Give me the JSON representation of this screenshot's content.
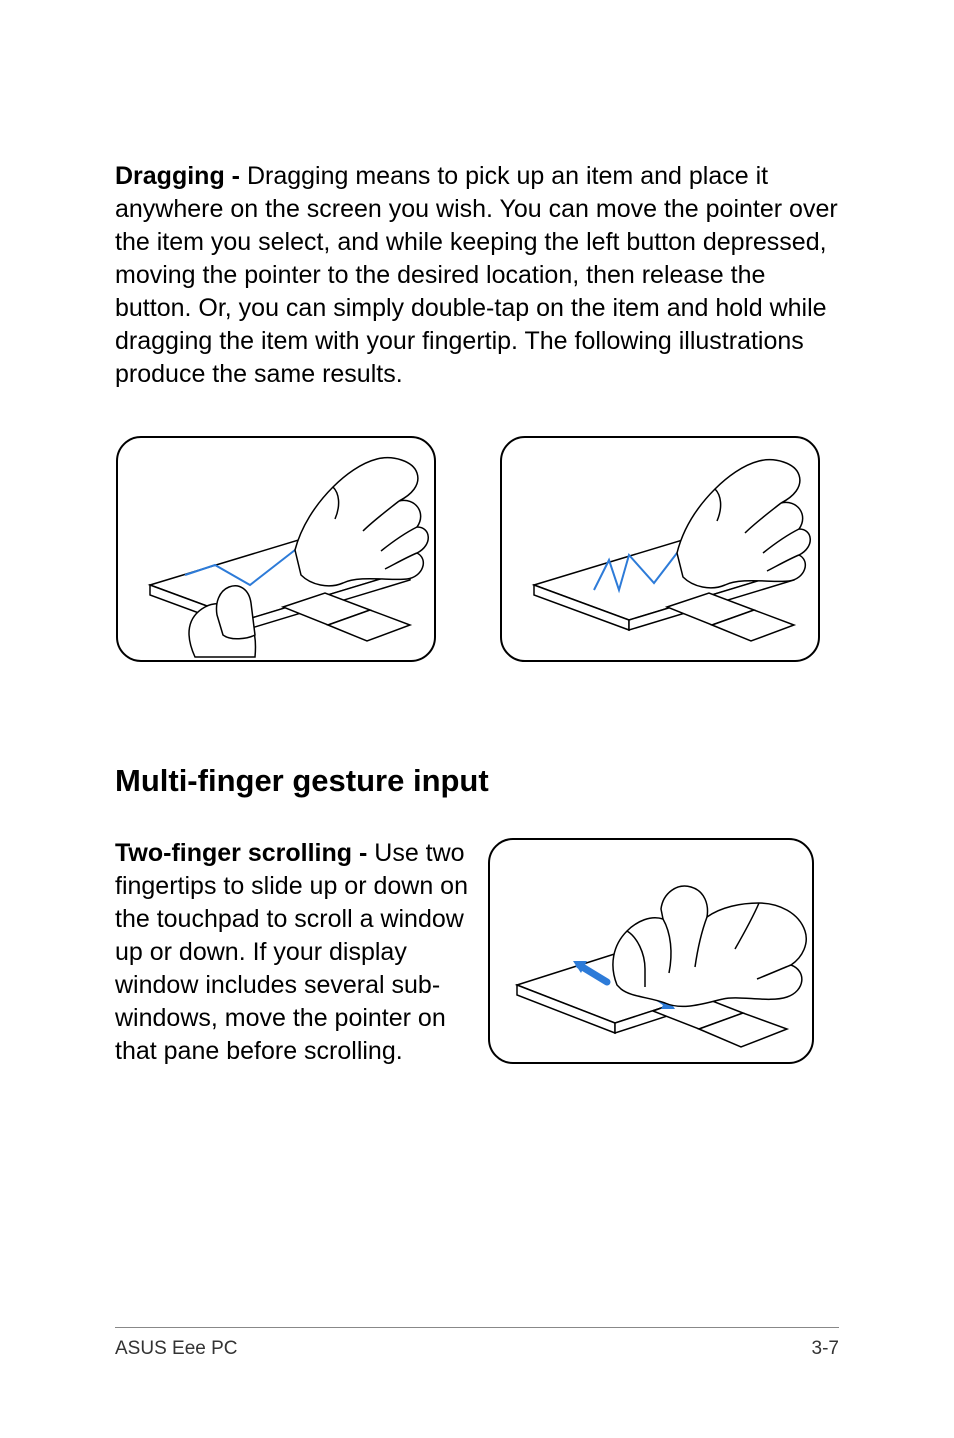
{
  "paragraph1_label": "Dragging - ",
  "paragraph1_body": "Dragging means to pick up an item and place it anywhere on the screen you wish. You can move the pointer over the item you select, and while keeping the left button depressed, moving the pointer to the desired location, then release the button. Or, you can simply double-tap on the item and hold while dragging the item with your fingertip. The following illustrations produce the same results.",
  "section_heading": "Multi-finger gesture input",
  "paragraph2_label": "Two-finger scrolling - ",
  "paragraph2_body": "Use two fingertips to slide up or down on the touchpad to scroll a window up or down. If your display window includes several sub-windows, move the pointer on that pane before scrolling.",
  "footer_left": "ASUS Eee PC",
  "footer_right": "3-7"
}
